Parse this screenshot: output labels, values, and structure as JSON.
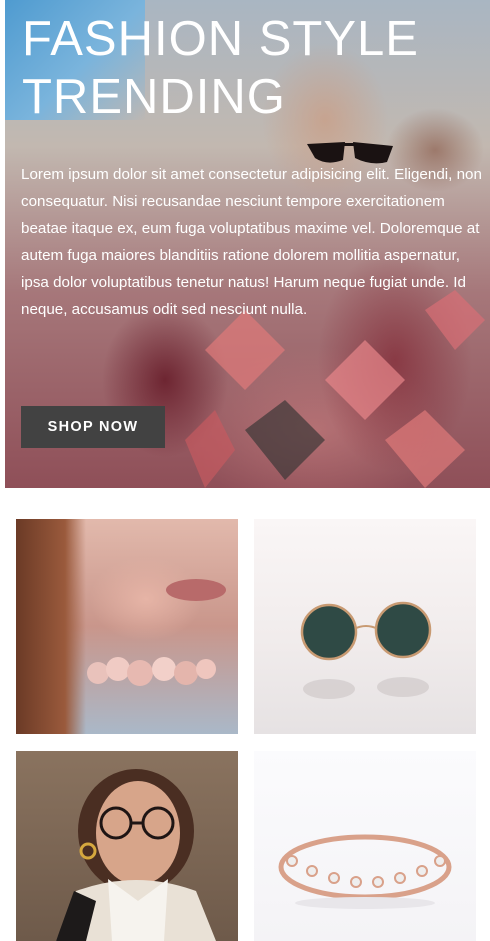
{
  "hero": {
    "title_line1": "FASHION STYLE",
    "title_line2": "TRENDING",
    "body": "Lorem ipsum dolor sit amet consectetur adipisicing elit. Eligendi, non consequatur. Nisi recusandae nesciunt tempore exercitationem beatae itaque ex, eum fuga voluptatibus maxime vel. Doloremque at autem fuga maiores blanditiis ratione dolorem mollitia aspernatur, ipsa dolor voluptatibus tenetur natus! Harum neque fugiat unde. Id neque, accusamus odit sed nesciunt nulla.",
    "cta_label": "SHOP NOW"
  },
  "gallery": {
    "items": [
      {
        "image": "woman-rose-choker-photo"
      },
      {
        "image": "round-sunglasses-photo"
      },
      {
        "image": "woman-with-glasses-photo"
      },
      {
        "image": "gold-diamond-ring-photo"
      }
    ]
  },
  "colors": {
    "button_bg": "#424242",
    "hero_text": "#ffffff",
    "page_bg": "#ffffff"
  }
}
